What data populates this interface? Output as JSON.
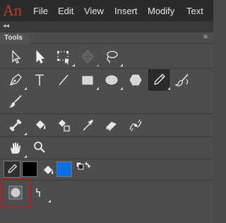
{
  "app": {
    "logo_text": "An"
  },
  "menu": {
    "items": [
      "File",
      "Edit",
      "View",
      "Insert",
      "Modify",
      "Text"
    ]
  },
  "panel": {
    "title": "Tools",
    "collapse_glyph": "◂◂"
  },
  "tools": {
    "row1": [
      "selection-tool",
      "subselection-tool",
      "free-transform-tool",
      "3d-rotation-tool",
      "lasso-tool"
    ],
    "row2": [
      "pen-tool",
      "text-tool",
      "line-tool",
      "rectangle-tool",
      "oval-tool",
      "polystar-tool",
      "pencil-tool",
      "brush-tool"
    ],
    "row3": [
      "paint-brush-tool"
    ],
    "row4": [
      "bone-tool",
      "paint-bucket-tool",
      "ink-bottle-tool",
      "eyedropper-tool",
      "eraser-tool",
      "width-tool"
    ],
    "row5": [
      "hand-tool",
      "zoom-tool"
    ],
    "row6": [
      "stroke-color",
      "stroke-swatch",
      "fill-color",
      "fill-swatch",
      "swap-colors"
    ],
    "row7": [
      "object-drawing-mode",
      "snap-to-objects"
    ],
    "active": "pencil-tool"
  },
  "colors": {
    "accent": "#c01818",
    "stroke": "#000000",
    "fill": "#0a6ee6",
    "logo": "#c43a2a"
  }
}
